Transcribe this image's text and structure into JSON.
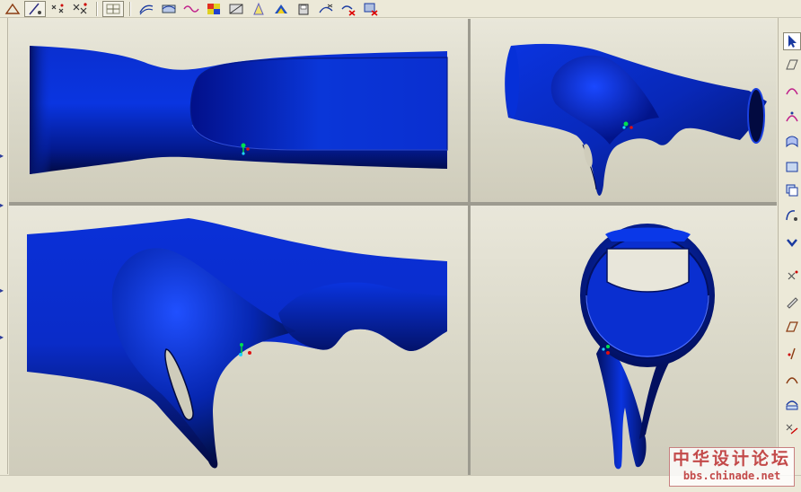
{
  "toolbar": {
    "buttons": [
      "sketch-icon",
      "curve-through-points-icon",
      "point-icon",
      "datum-point-icon",
      "datum-plane-icon",
      "surface-icon",
      "boundary-blend-icon",
      "style-curve-icon",
      "color-analysis-icon",
      "shaded-icon",
      "draft-analysis-icon",
      "reflection-icon",
      "save-icon",
      "trim-icon",
      "delete-curve-icon",
      "delete-surface-icon"
    ]
  },
  "right_toolbar": {
    "buttons": [
      "select-arrow-icon",
      "datum-plane-icon",
      "arc-curve-icon",
      "circle-curve-icon",
      "surface-icon",
      "boundary-surface-icon",
      "copy-surface-icon",
      "curve-on-surface-icon",
      "chevron-down-icon",
      "point-icon",
      "pen-icon",
      "plane-icon",
      "edit-curve-icon",
      "arc-icon",
      "combine-icon",
      "trim-icon"
    ]
  },
  "watermark": {
    "cn": "中华设计论坛",
    "url": "bbs.chinade.net"
  },
  "colors": {
    "model_blue": "#0a2fd0",
    "model_dark": "#020a40",
    "model_mid": "#0322a0",
    "background": "#ece9d8"
  }
}
